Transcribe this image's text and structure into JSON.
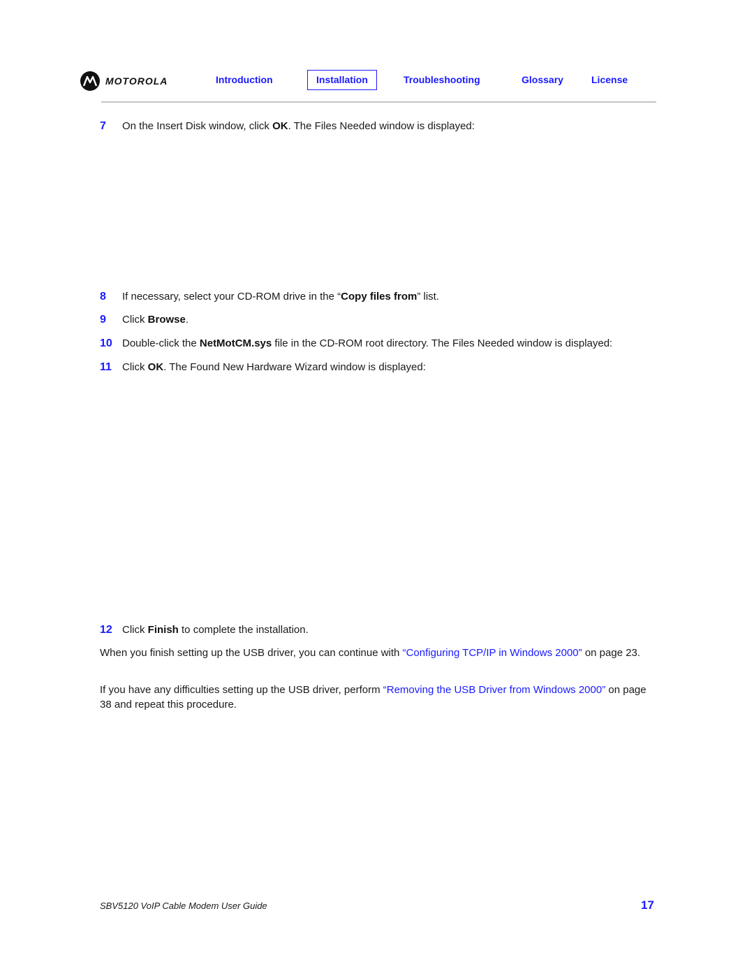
{
  "header": {
    "brand": "MOTOROLA",
    "nav": [
      {
        "label": "Introduction",
        "active": false
      },
      {
        "label": "Installation",
        "active": true
      },
      {
        "label": "Troubleshooting",
        "active": false
      },
      {
        "label": "Glossary",
        "active": false
      },
      {
        "label": "License",
        "active": false
      }
    ]
  },
  "steps": [
    {
      "num": "7",
      "pre": "On the Insert Disk window, click ",
      "bold": "OK",
      "post": ". The Files Needed window is displayed:"
    },
    {
      "num": "8",
      "pre": "If necessary, select your CD-ROM drive in the “",
      "bold": "Copy files from",
      "post": "” list."
    },
    {
      "num": "9",
      "pre": "Click ",
      "bold": "Browse",
      "post": "."
    },
    {
      "num": "10",
      "pre": "Double-click the ",
      "bold": "NetMotCM.sys",
      "post": " file in the CD-ROM root directory. The Files Needed window is displayed:"
    },
    {
      "num": "11",
      "pre": "Click ",
      "bold": "OK",
      "post": ". The Found New Hardware Wizard window is displayed:"
    },
    {
      "num": "12",
      "pre": "Click ",
      "bold": "Finish",
      "post": " to complete the installation."
    }
  ],
  "paragraphs": [
    {
      "pre": "When you finish setting up the USB driver, you can continue with ",
      "link": "“Configuring TCP/IP in Windows 2000”",
      "post": " on page 23."
    },
    {
      "pre": "If you have any difficulties setting up the USB driver, perform ",
      "link": "“Removing the USB Driver from Windows 2000”",
      "post": " on page 38 and repeat this procedure."
    }
  ],
  "footer": {
    "title": "SBV5120 VoIP Cable Modem User Guide",
    "page": "17"
  }
}
